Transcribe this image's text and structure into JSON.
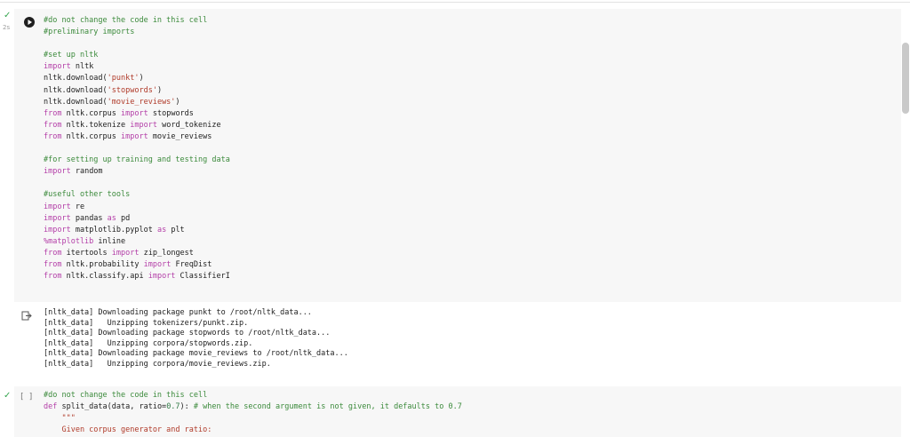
{
  "cell1": {
    "exec_time": "2s",
    "lines": [
      [
        {
          "t": "#do not change the code in this cell",
          "c": "cmt"
        }
      ],
      [
        {
          "t": "#preliminary imports",
          "c": "cmt"
        }
      ],
      [],
      [
        {
          "t": "#set up nltk",
          "c": "cmt"
        }
      ],
      [
        {
          "t": "import",
          "c": "kw"
        },
        {
          "t": " nltk"
        }
      ],
      [
        {
          "t": "nltk.download("
        },
        {
          "t": "'punkt'",
          "c": "str"
        },
        {
          "t": ")"
        }
      ],
      [
        {
          "t": "nltk.download("
        },
        {
          "t": "'stopwords'",
          "c": "str"
        },
        {
          "t": ")"
        }
      ],
      [
        {
          "t": "nltk.download("
        },
        {
          "t": "'movie_reviews'",
          "c": "str"
        },
        {
          "t": ")"
        }
      ],
      [
        {
          "t": "from",
          "c": "kw"
        },
        {
          "t": " nltk.corpus "
        },
        {
          "t": "import",
          "c": "kw"
        },
        {
          "t": " stopwords"
        }
      ],
      [
        {
          "t": "from",
          "c": "kw"
        },
        {
          "t": " nltk.tokenize "
        },
        {
          "t": "import",
          "c": "kw"
        },
        {
          "t": " word_tokenize"
        }
      ],
      [
        {
          "t": "from",
          "c": "kw"
        },
        {
          "t": " nltk.corpus "
        },
        {
          "t": "import",
          "c": "kw"
        },
        {
          "t": " movie_reviews"
        }
      ],
      [],
      [
        {
          "t": "#for setting up training and testing data",
          "c": "cmt"
        }
      ],
      [
        {
          "t": "import",
          "c": "kw"
        },
        {
          "t": " random"
        }
      ],
      [],
      [
        {
          "t": "#useful other tools",
          "c": "cmt"
        }
      ],
      [
        {
          "t": "import",
          "c": "kw"
        },
        {
          "t": " re"
        }
      ],
      [
        {
          "t": "import",
          "c": "kw"
        },
        {
          "t": " pandas "
        },
        {
          "t": "as",
          "c": "kw"
        },
        {
          "t": " pd"
        }
      ],
      [
        {
          "t": "import",
          "c": "kw"
        },
        {
          "t": " matplotlib.pyplot "
        },
        {
          "t": "as",
          "c": "kw"
        },
        {
          "t": " plt"
        }
      ],
      [
        {
          "t": "%matplotlib",
          "c": "kw"
        },
        {
          "t": " inline"
        }
      ],
      [
        {
          "t": "from",
          "c": "kw"
        },
        {
          "t": " itertools "
        },
        {
          "t": "import",
          "c": "kw"
        },
        {
          "t": " zip_longest"
        }
      ],
      [
        {
          "t": "from",
          "c": "kw"
        },
        {
          "t": " nltk.probability "
        },
        {
          "t": "import",
          "c": "kw"
        },
        {
          "t": " FreqDist"
        }
      ],
      [
        {
          "t": "from",
          "c": "kw"
        },
        {
          "t": " nltk.classify.api "
        },
        {
          "t": "import",
          "c": "kw"
        },
        {
          "t": " ClassifierI"
        }
      ]
    ]
  },
  "output1": {
    "lines": [
      "[nltk_data] Downloading package punkt to /root/nltk_data...",
      "[nltk_data]   Unzipping tokenizers/punkt.zip.",
      "[nltk_data] Downloading package stopwords to /root/nltk_data...",
      "[nltk_data]   Unzipping corpora/stopwords.zip.",
      "[nltk_data] Downloading package movie_reviews to /root/nltk_data...",
      "[nltk_data]   Unzipping corpora/movie_reviews.zip."
    ]
  },
  "cell2": {
    "exec_count": "[ ]",
    "lines": [
      [
        {
          "t": "#do not change the code in this cell",
          "c": "cmt"
        }
      ],
      [
        {
          "t": "def",
          "c": "kw"
        },
        {
          "t": " split_data(data, ratio="
        },
        {
          "t": "0.7",
          "c": "num"
        },
        {
          "t": "): "
        },
        {
          "t": "# when the second argument is not given, it defaults to 0.7",
          "c": "cmt"
        }
      ],
      [
        {
          "t": "    \"\"\"",
          "c": "str"
        }
      ],
      [
        {
          "t": "    Given corpus generator and ratio:",
          "c": "str"
        }
      ]
    ]
  }
}
